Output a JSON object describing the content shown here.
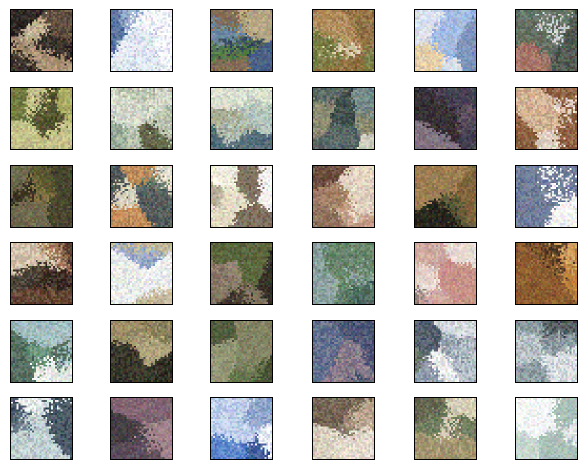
{
  "grid": {
    "rows": 6,
    "cols": 6,
    "tiles": [
      {
        "palette": [
          "#5a4a3a",
          "#b69b7c",
          "#2a2420",
          "#d9c7a8",
          "#7d6b55",
          "#1e1a18"
        ]
      },
      {
        "palette": [
          "#ffffff",
          "#f5f7fb",
          "#e6ecf5",
          "#8da3c8",
          "#3c5a8e",
          "#ffffff"
        ]
      },
      {
        "palette": [
          "#3f5a8c",
          "#8a6a4c",
          "#4e7a3a",
          "#c9b48a",
          "#2f3e5a",
          "#6e8fb0"
        ]
      },
      {
        "palette": [
          "#e6d9b8",
          "#b58c5a",
          "#6f7a3e",
          "#f2ead2",
          "#8f6a3a",
          "#3d3a22"
        ]
      },
      {
        "palette": [
          "#9bb8e8",
          "#dfe8f7",
          "#f0d2a0",
          "#ffffff",
          "#6b87b8",
          "#c9a06a"
        ]
      },
      {
        "palette": [
          "#8a98a8",
          "#c9ced6",
          "#5a6a5a",
          "#a86a5a",
          "#e2e6ea",
          "#3d4a3e"
        ]
      },
      {
        "palette": [
          "#6e7a3a",
          "#b7b86a",
          "#2a2a1e",
          "#d6d29a",
          "#4a4a2a",
          "#8e8a4e"
        ]
      },
      {
        "palette": [
          "#4a6a78",
          "#c8d0b8",
          "#1e2a2e",
          "#9ab0a0",
          "#e8eadc",
          "#5a5a3a"
        ]
      },
      {
        "palette": [
          "#e8ecd8",
          "#b8c8c0",
          "#7a9aa8",
          "#3e5a6a",
          "#f4f0e0",
          "#a8a88a"
        ]
      },
      {
        "palette": [
          "#c8cfc0",
          "#6f8a8a",
          "#2f3e3e",
          "#e0dccb",
          "#8e8a6a",
          "#4e5e5e"
        ]
      },
      {
        "palette": [
          "#5a4a5a",
          "#2a2228",
          "#8a7a8a",
          "#3e3a4e",
          "#b0a0a8",
          "#6a6a50"
        ]
      },
      {
        "palette": [
          "#b8864e",
          "#f0e8e0",
          "#5a3a2a",
          "#e0c0a0",
          "#8a5a3a",
          "#2a1e18"
        ]
      },
      {
        "palette": [
          "#5a5a2e",
          "#8e7a4a",
          "#2e2a1e",
          "#b0a070",
          "#3e3e2a",
          "#6e6a50"
        ]
      },
      {
        "palette": [
          "#e8e0c8",
          "#a0b0a0",
          "#c8884e",
          "#f6f0e0",
          "#6a7a6a",
          "#3e4a4e"
        ]
      },
      {
        "palette": [
          "#fbf8ea",
          "#e8e2c8",
          "#b0a890",
          "#ffffff",
          "#6a5a4a",
          "#d4c8a8"
        ]
      },
      {
        "palette": [
          "#c8a088",
          "#8a6a58",
          "#e8d0b8",
          "#5a3e30",
          "#f0e4d4",
          "#a07a60"
        ]
      },
      {
        "palette": [
          "#3e3a2a",
          "#1e1e18",
          "#8a6a3e",
          "#5a5a3a",
          "#b08a5a",
          "#2a2a22"
        ]
      },
      {
        "palette": [
          "#e8eef8",
          "#c8a878",
          "#ffffff",
          "#8aa0c8",
          "#f0e0c0",
          "#5a6a8e"
        ]
      },
      {
        "palette": [
          "#5a3a2a",
          "#e8d8c0",
          "#2a1e18",
          "#a87a58",
          "#c0a890",
          "#3e3a30"
        ]
      },
      {
        "palette": [
          "#ffffff",
          "#e0e6f0",
          "#8aa0c8",
          "#c8b890",
          "#5a6a8e",
          "#f4f4f0"
        ]
      },
      {
        "palette": [
          "#6a5a48",
          "#3a3228",
          "#a09080",
          "#5a6a3a",
          "#2a2822",
          "#8a7a68"
        ]
      },
      {
        "palette": [
          "#a0c0c8",
          "#d8e8e8",
          "#5a7a5a",
          "#e8f0f0",
          "#3e5a4e",
          "#8aa0a0"
        ]
      },
      {
        "palette": [
          "#d0a8a0",
          "#b8a890",
          "#e8d8d0",
          "#8a7a78",
          "#c88a80",
          "#f0e8e0"
        ]
      },
      {
        "palette": [
          "#8a5a2e",
          "#c8883e",
          "#5a3e2a",
          "#e0b070",
          "#3e2a1e",
          "#a06a3a"
        ]
      },
      {
        "palette": [
          "#e8f0f0",
          "#5a8a6e",
          "#a0c0c8",
          "#3e5a4e",
          "#ffffff",
          "#c8a060"
        ]
      },
      {
        "palette": [
          "#2a2a22",
          "#8a8058",
          "#c0b088",
          "#1a1a16",
          "#5a5a3e",
          "#a89870"
        ]
      },
      {
        "palette": [
          "#3e4a2e",
          "#6a7a4e",
          "#2a3022",
          "#8a8a6a",
          "#4e5a3a",
          "#a0a080"
        ]
      },
      {
        "palette": [
          "#3e4a6e",
          "#e8c8a8",
          "#1e2a3e",
          "#8a7a8a",
          "#f0d8c0",
          "#5a6a8e"
        ]
      },
      {
        "palette": [
          "#e0e4ea",
          "#8a98a8",
          "#3e4a5a",
          "#ffffff",
          "#5a6a5a",
          "#c0c8d0"
        ]
      },
      {
        "palette": [
          "#e8ecf0",
          "#3e4a4e",
          "#8a9aa0",
          "#ffffff",
          "#1e2a2e",
          "#c0c8cc"
        ]
      },
      {
        "palette": [
          "#ffffff",
          "#e8f0f0",
          "#5a6a7a",
          "#c8d8d8",
          "#2e3e4e",
          "#a0b0b8"
        ]
      },
      {
        "palette": [
          "#5a4a5a",
          "#8a6a78",
          "#2a2228",
          "#b09098",
          "#3e3a3e",
          "#6a5a6a"
        ]
      },
      {
        "palette": [
          "#4a7ac8",
          "#c8d8f0",
          "#2a4a8e",
          "#ffffff",
          "#8aa0c8",
          "#e8eef8"
        ]
      },
      {
        "palette": [
          "#e8e0d0",
          "#6a5a4a",
          "#c0a890",
          "#3e3a30",
          "#f4ece0",
          "#8a7a68"
        ]
      },
      {
        "palette": [
          "#c8b890",
          "#6a7a5a",
          "#e8e0c8",
          "#3e4a3a",
          "#a89870",
          "#5a5a4a"
        ]
      },
      {
        "palette": [
          "#e8eef0",
          "#c8d8d0",
          "#ffffff",
          "#a0b8b0",
          "#f0f4f4",
          "#8aa098"
        ]
      }
    ]
  }
}
